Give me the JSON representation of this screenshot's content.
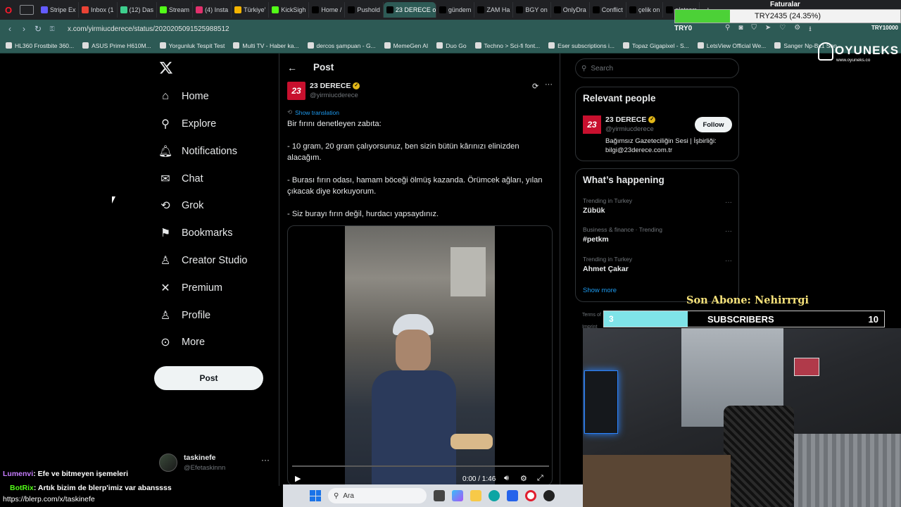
{
  "browser": {
    "tabs": [
      {
        "label": "Stripe Ex",
        "color": "#635bff"
      },
      {
        "label": "Inbox (1",
        "color": "#ea4335"
      },
      {
        "label": "(12) Das",
        "color": "#3ecf8e"
      },
      {
        "label": "Stream",
        "color": "#53fc18"
      },
      {
        "label": "(4) Insta",
        "color": "#e1306c"
      },
      {
        "label": "Türkiye'",
        "color": "#f4b400"
      },
      {
        "label": "KickSigh",
        "color": "#53fc18"
      },
      {
        "label": "Home /",
        "color": "#000000"
      },
      {
        "label": "Pushold",
        "color": "#000000"
      },
      {
        "label": "23 DERECE on",
        "color": "#000000",
        "active": true
      },
      {
        "label": "gündem",
        "color": "#000000"
      },
      {
        "label": "ZAM Ha",
        "color": "#000000"
      },
      {
        "label": "BGY on",
        "color": "#000000"
      },
      {
        "label": "OnlyDra",
        "color": "#000000"
      },
      {
        "label": "Conflict",
        "color": "#000000"
      },
      {
        "label": "çelik on",
        "color": "#000000"
      },
      {
        "label": "platcorr",
        "color": "#000000"
      }
    ],
    "url": "x.com/yirmiucderece/status/2020205091525988512",
    "bookmarks": [
      "HL360 Frostbite 360...",
      "ASUS Prime H610M...",
      "Yorgunluk Tespit Test",
      "Multi TV - Haber ka...",
      "dercos şampuan - G...",
      "MemeGen AI",
      "Duo Go",
      "Techno > Sci-fi font...",
      "Eser subscriptions i...",
      "Topaz Gigapixel - S...",
      "LetsView Official We...",
      "Sanger Np-Bx1 Son..."
    ]
  },
  "nav": {
    "items": [
      {
        "label": "Home",
        "icon": "home-icon"
      },
      {
        "label": "Explore",
        "icon": "search-icon"
      },
      {
        "label": "Notifications",
        "icon": "bell-icon"
      },
      {
        "label": "Chat",
        "icon": "mail-icon"
      },
      {
        "label": "Grok",
        "icon": "grok-icon"
      },
      {
        "label": "Bookmarks",
        "icon": "bookmark-icon"
      },
      {
        "label": "Creator Studio",
        "icon": "creator-icon"
      },
      {
        "label": "Premium",
        "icon": "x-logo-icon"
      },
      {
        "label": "Profile",
        "icon": "person-icon"
      },
      {
        "label": "More",
        "icon": "more-circle-icon"
      }
    ],
    "post_button": "Post",
    "account": {
      "name": "taskinefe",
      "handle": "@Efetaskinnn"
    }
  },
  "post": {
    "header": "Post",
    "author_name": "23 DERECE",
    "author_handle": "@yirmiucderece",
    "show_translation": "Show translation",
    "text": {
      "line1": "Bir fırını denetleyen zabıta:",
      "line2": "- 10 gram, 20 gram çalıyorsunuz, ben sizin bütün kârınızı elinizden alacağım.",
      "line3": "- Burası fırın odası, hamam böceği ölmüş kazanda. Örümcek ağları, yılan çıkacak diye korkuyorum.",
      "line4": "- Siz burayı fırın değil, hurdacı yapsaydınız."
    },
    "video_time": "0:00 / 1:46",
    "avatar_text": "23"
  },
  "right": {
    "search_placeholder": "Search",
    "relevant_title": "Relevant people",
    "person": {
      "name": "23 DERECE",
      "handle": "@yirmiucderece",
      "bio": "Bağımsız Gazeteciliğin Sesi | İşbirliği: bilgi@23derece.com.tr",
      "follow": "Follow"
    },
    "happening_title": "What’s happening",
    "trends": [
      {
        "meta": "Trending in Turkey",
        "name": "Zübük"
      },
      {
        "meta": "Business & finance · Trending",
        "name": "#petkm"
      },
      {
        "meta": "Trending in Turkey",
        "name": "Ahmet Çakar"
      }
    ],
    "show_more": "Show more"
  },
  "overlay": {
    "faturalar": "Faturalar",
    "goal_text": "TRY2435 (24.35%)",
    "goal_left": "TRY0",
    "goal_right": "TRY10000",
    "goal_fraction": 0.2435,
    "brand": "OYUNEKS",
    "brand_url": "www.oyuneks.co",
    "son_abone": "Son Abone: Nehirrrgi",
    "sub_current": "3",
    "sub_label": "SUBSCRIBERS",
    "sub_goal": "10",
    "sub_fraction": 0.3
  },
  "chat": [
    {
      "user": "Lumenvi",
      "text": ": Efe ve bitmeyen işemeleri",
      "color": "#c77dff"
    },
    {
      "user": "BotRix",
      "text": ": Artık bizim de blerp'imiz var abanssss",
      "color": "#53fc18"
    },
    {
      "user": "",
      "text": "https://blerp.com/x/taskinefe",
      "color": "#ffffff"
    }
  ],
  "taskbar": {
    "search_placeholder": "Ara"
  }
}
